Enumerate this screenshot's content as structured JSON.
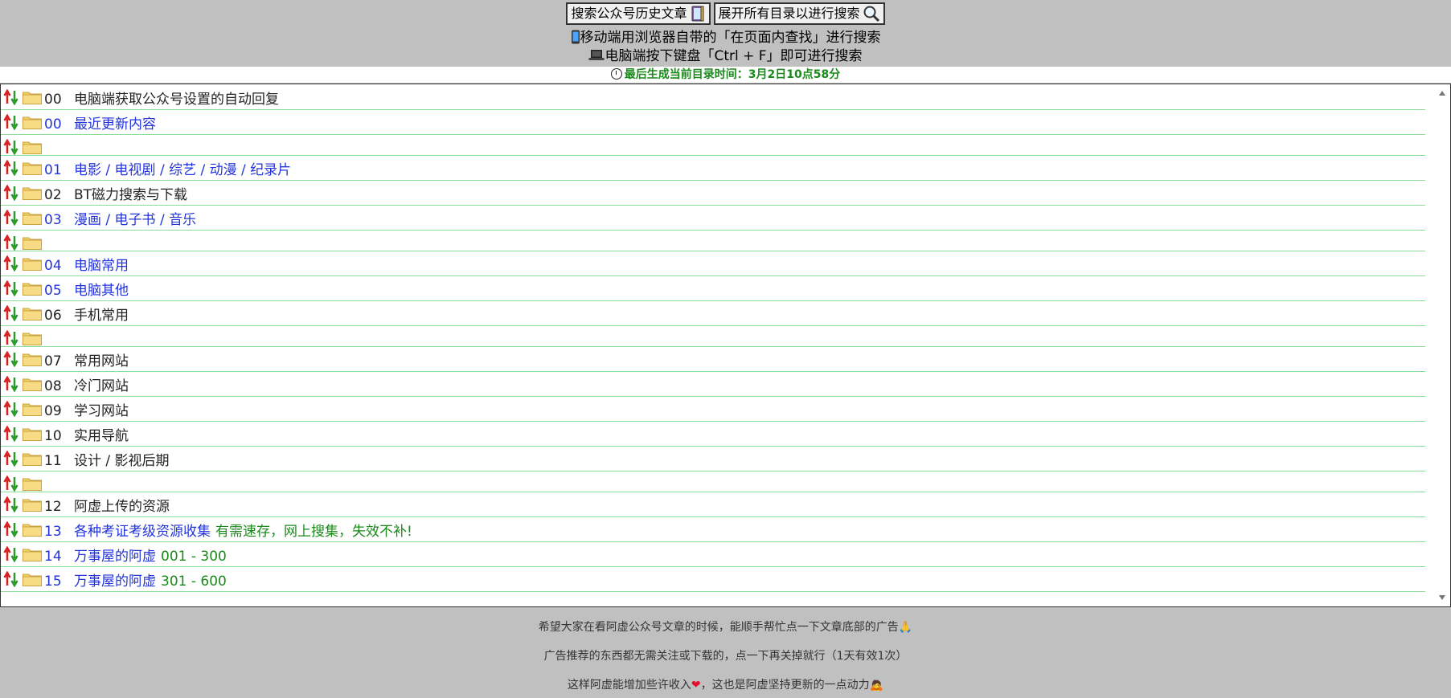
{
  "top": {
    "search_history_label": "搜索公众号历史文章",
    "expand_all_label": "展开所有目录以进行搜索"
  },
  "hints": {
    "mobile": "移动端用浏览器自带的「在页面内查找」进行搜索",
    "desktop": "电脑端按下键盘「Ctrl + F」即可进行搜索"
  },
  "updated_text": "最后生成当前目录时间：3月2日10点58分",
  "rows": [
    {
      "num": "00",
      "label": "电脑端获取公众号设置的自动回复",
      "color": "dark",
      "note": ""
    },
    {
      "num": "00",
      "label": "最近更新内容",
      "color": "blue",
      "note": ""
    },
    {
      "num": "",
      "label": "",
      "color": "dark",
      "note": ""
    },
    {
      "num": "01",
      "label": "电影 / 电视剧 / 综艺 / 动漫 / 纪录片",
      "color": "blue",
      "note": ""
    },
    {
      "num": "02",
      "label": "BT磁力搜索与下载",
      "color": "dark",
      "note": ""
    },
    {
      "num": "03",
      "label": "漫画 / 电子书 / 音乐",
      "color": "blue",
      "note": ""
    },
    {
      "num": "",
      "label": "",
      "color": "dark",
      "note": ""
    },
    {
      "num": "04",
      "label": "电脑常用",
      "color": "blue",
      "note": ""
    },
    {
      "num": "05",
      "label": "电脑其他",
      "color": "blue",
      "note": ""
    },
    {
      "num": "06",
      "label": "手机常用",
      "color": "dark",
      "note": ""
    },
    {
      "num": "",
      "label": "",
      "color": "dark",
      "note": ""
    },
    {
      "num": "07",
      "label": "常用网站",
      "color": "dark",
      "note": ""
    },
    {
      "num": "08",
      "label": "冷门网站",
      "color": "dark",
      "note": ""
    },
    {
      "num": "09",
      "label": "学习网站",
      "color": "dark",
      "note": ""
    },
    {
      "num": "10",
      "label": "实用导航",
      "color": "dark",
      "note": ""
    },
    {
      "num": "11",
      "label": "设计 / 影视后期",
      "color": "dark",
      "note": ""
    },
    {
      "num": "",
      "label": "",
      "color": "dark",
      "note": ""
    },
    {
      "num": "12",
      "label": "阿虚上传的资源",
      "color": "dark",
      "note": ""
    },
    {
      "num": "13",
      "label": "各种考证考级资源收集",
      "color": "blue",
      "note": "有需速存，网上搜集，失效不补!"
    },
    {
      "num": "14",
      "label": "万事屋的阿虚",
      "color": "blue",
      "note": "001 - 300"
    },
    {
      "num": "15",
      "label": "万事屋的阿虚",
      "color": "blue",
      "note": "301 - 600"
    }
  ],
  "footer": {
    "line1": "希望大家在看阿虚公众号文章的时候，能顺手帮忙点一下文章底部的广告🙏",
    "line2": "广告推荐的东西都无需关注或下载的，点一下再关掉就行（1天有效1次）",
    "line3_a": "这样阿虚能增加些许收入",
    "line3_b": "，这也是阿虚坚持更新的一点动力🙇"
  },
  "icons": {
    "phone": "mobile-phone-icon",
    "laptop": "laptop-icon",
    "search": "magnifier-icon",
    "book": "book-icon",
    "clock": "clock-icon",
    "heart": "heart-icon",
    "sort": "sort-arrows-icon",
    "folder": "folder-icon"
  },
  "colors": {
    "background": "#c0c0c0",
    "link_blue": "#2233dd",
    "note_green": "#1a8a1a",
    "row_divider": "#88dd99",
    "folder_yellow": "#f2d06b"
  }
}
